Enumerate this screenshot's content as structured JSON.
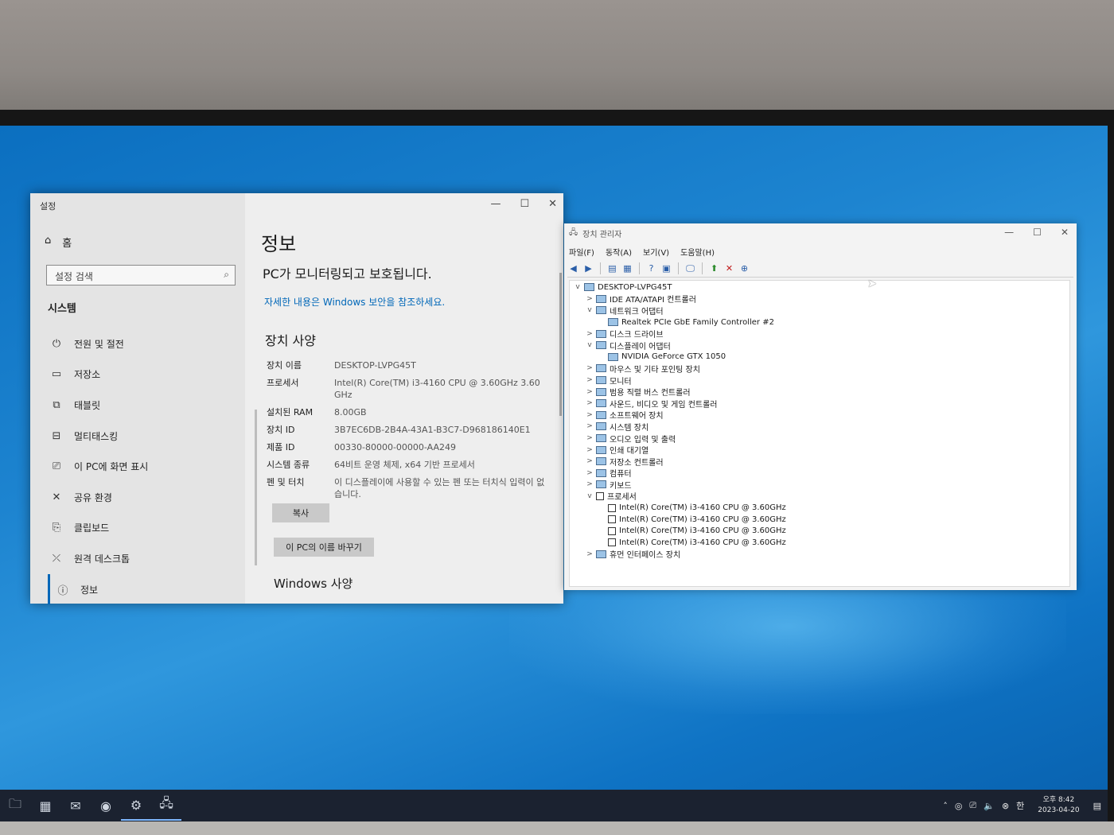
{
  "settings": {
    "window_title": "설정",
    "home_label": "홈",
    "search_placeholder": "설정 검색",
    "section_label": "시스템",
    "nav_items": [
      {
        "label": "전원 및 절전"
      },
      {
        "label": "저장소"
      },
      {
        "label": "태블릿"
      },
      {
        "label": "멀티태스킹"
      },
      {
        "label": "이 PC에 화면 표시"
      },
      {
        "label": "공유 환경"
      },
      {
        "label": "클립보드"
      },
      {
        "label": "원격 데스크톱"
      },
      {
        "label": "정보"
      }
    ],
    "page_title": "정보",
    "protection_text": "PC가 모니터링되고 보호됩니다.",
    "security_link": "자세한 내용은 Windows 보안을 참조하세요.",
    "spec_heading": "장치 사양",
    "specs": [
      {
        "key": "장치 이름",
        "value": "DESKTOP-LVPG45T"
      },
      {
        "key": "프로세서",
        "value": "Intel(R) Core(TM) i3-4160 CPU @ 3.60GHz   3.60 GHz"
      },
      {
        "key": "설치된 RAM",
        "value": "8.00GB"
      },
      {
        "key": "장치 ID",
        "value": "3B7EC6DB-2B4A-43A1-B3C7-D968186140E1"
      },
      {
        "key": "제품 ID",
        "value": "00330-80000-00000-AA249"
      },
      {
        "key": "시스템 종류",
        "value": "64비트 운영 체제, x64 기반 프로세서"
      },
      {
        "key": "펜 및 터치",
        "value": "이 디스플레이에 사용할 수 있는 펜 또는 터치식 입력이 없습니다."
      }
    ],
    "copy_button": "복사",
    "rename_button": "이 PC의 이름 바꾸기",
    "windows_spec_heading": "Windows 사양"
  },
  "device_manager": {
    "window_title": "장치 관리자",
    "menu": [
      "파일(F)",
      "동작(A)",
      "보기(V)",
      "도움말(H)"
    ],
    "tree": [
      {
        "label": "DESKTOP-LVPG45T",
        "level": 0,
        "expander": "v"
      },
      {
        "label": "IDE ATA/ATAPI 컨트롤러",
        "level": 1,
        "expander": ">"
      },
      {
        "label": "네트워크 어댑터",
        "level": 1,
        "expander": "v"
      },
      {
        "label": "Realtek PCIe GbE Family Controller #2",
        "level": 2,
        "expander": ""
      },
      {
        "label": "디스크 드라이브",
        "level": 1,
        "expander": ">"
      },
      {
        "label": "디스플레이 어댑터",
        "level": 1,
        "expander": "v"
      },
      {
        "label": "NVIDIA GeForce GTX 1050",
        "level": 2,
        "expander": ""
      },
      {
        "label": "마우스 및 기타 포인팅 장치",
        "level": 1,
        "expander": ">"
      },
      {
        "label": "모니터",
        "level": 1,
        "expander": ">"
      },
      {
        "label": "범용 직렬 버스 컨트롤러",
        "level": 1,
        "expander": ">"
      },
      {
        "label": "사운드, 비디오 및 게임 컨트롤러",
        "level": 1,
        "expander": ">"
      },
      {
        "label": "소프트웨어 장치",
        "level": 1,
        "expander": ">"
      },
      {
        "label": "시스템 장치",
        "level": 1,
        "expander": ">"
      },
      {
        "label": "오디오 입력 및 출력",
        "level": 1,
        "expander": ">"
      },
      {
        "label": "인쇄 대기열",
        "level": 1,
        "expander": ">"
      },
      {
        "label": "저장소 컨트롤러",
        "level": 1,
        "expander": ">"
      },
      {
        "label": "컴퓨터",
        "level": 1,
        "expander": ">"
      },
      {
        "label": "키보드",
        "level": 1,
        "expander": ">"
      },
      {
        "label": "프로세서",
        "level": 1,
        "expander": "v"
      },
      {
        "label": "Intel(R) Core(TM) i3-4160 CPU @ 3.60GHz",
        "level": 2,
        "expander": ""
      },
      {
        "label": "Intel(R) Core(TM) i3-4160 CPU @ 3.60GHz",
        "level": 2,
        "expander": ""
      },
      {
        "label": "Intel(R) Core(TM) i3-4160 CPU @ 3.60GHz",
        "level": 2,
        "expander": ""
      },
      {
        "label": "Intel(R) Core(TM) i3-4160 CPU @ 3.60GHz",
        "level": 2,
        "expander": ""
      },
      {
        "label": "휴먼 인터페이스 장치",
        "level": 1,
        "expander": ">"
      }
    ]
  },
  "taskbar": {
    "time": "오후 8:42",
    "date": "2023-04-20"
  },
  "colors": {
    "accent": "#0067b8",
    "taskbar": "#1b2230",
    "desktop": "#1d84d0"
  }
}
